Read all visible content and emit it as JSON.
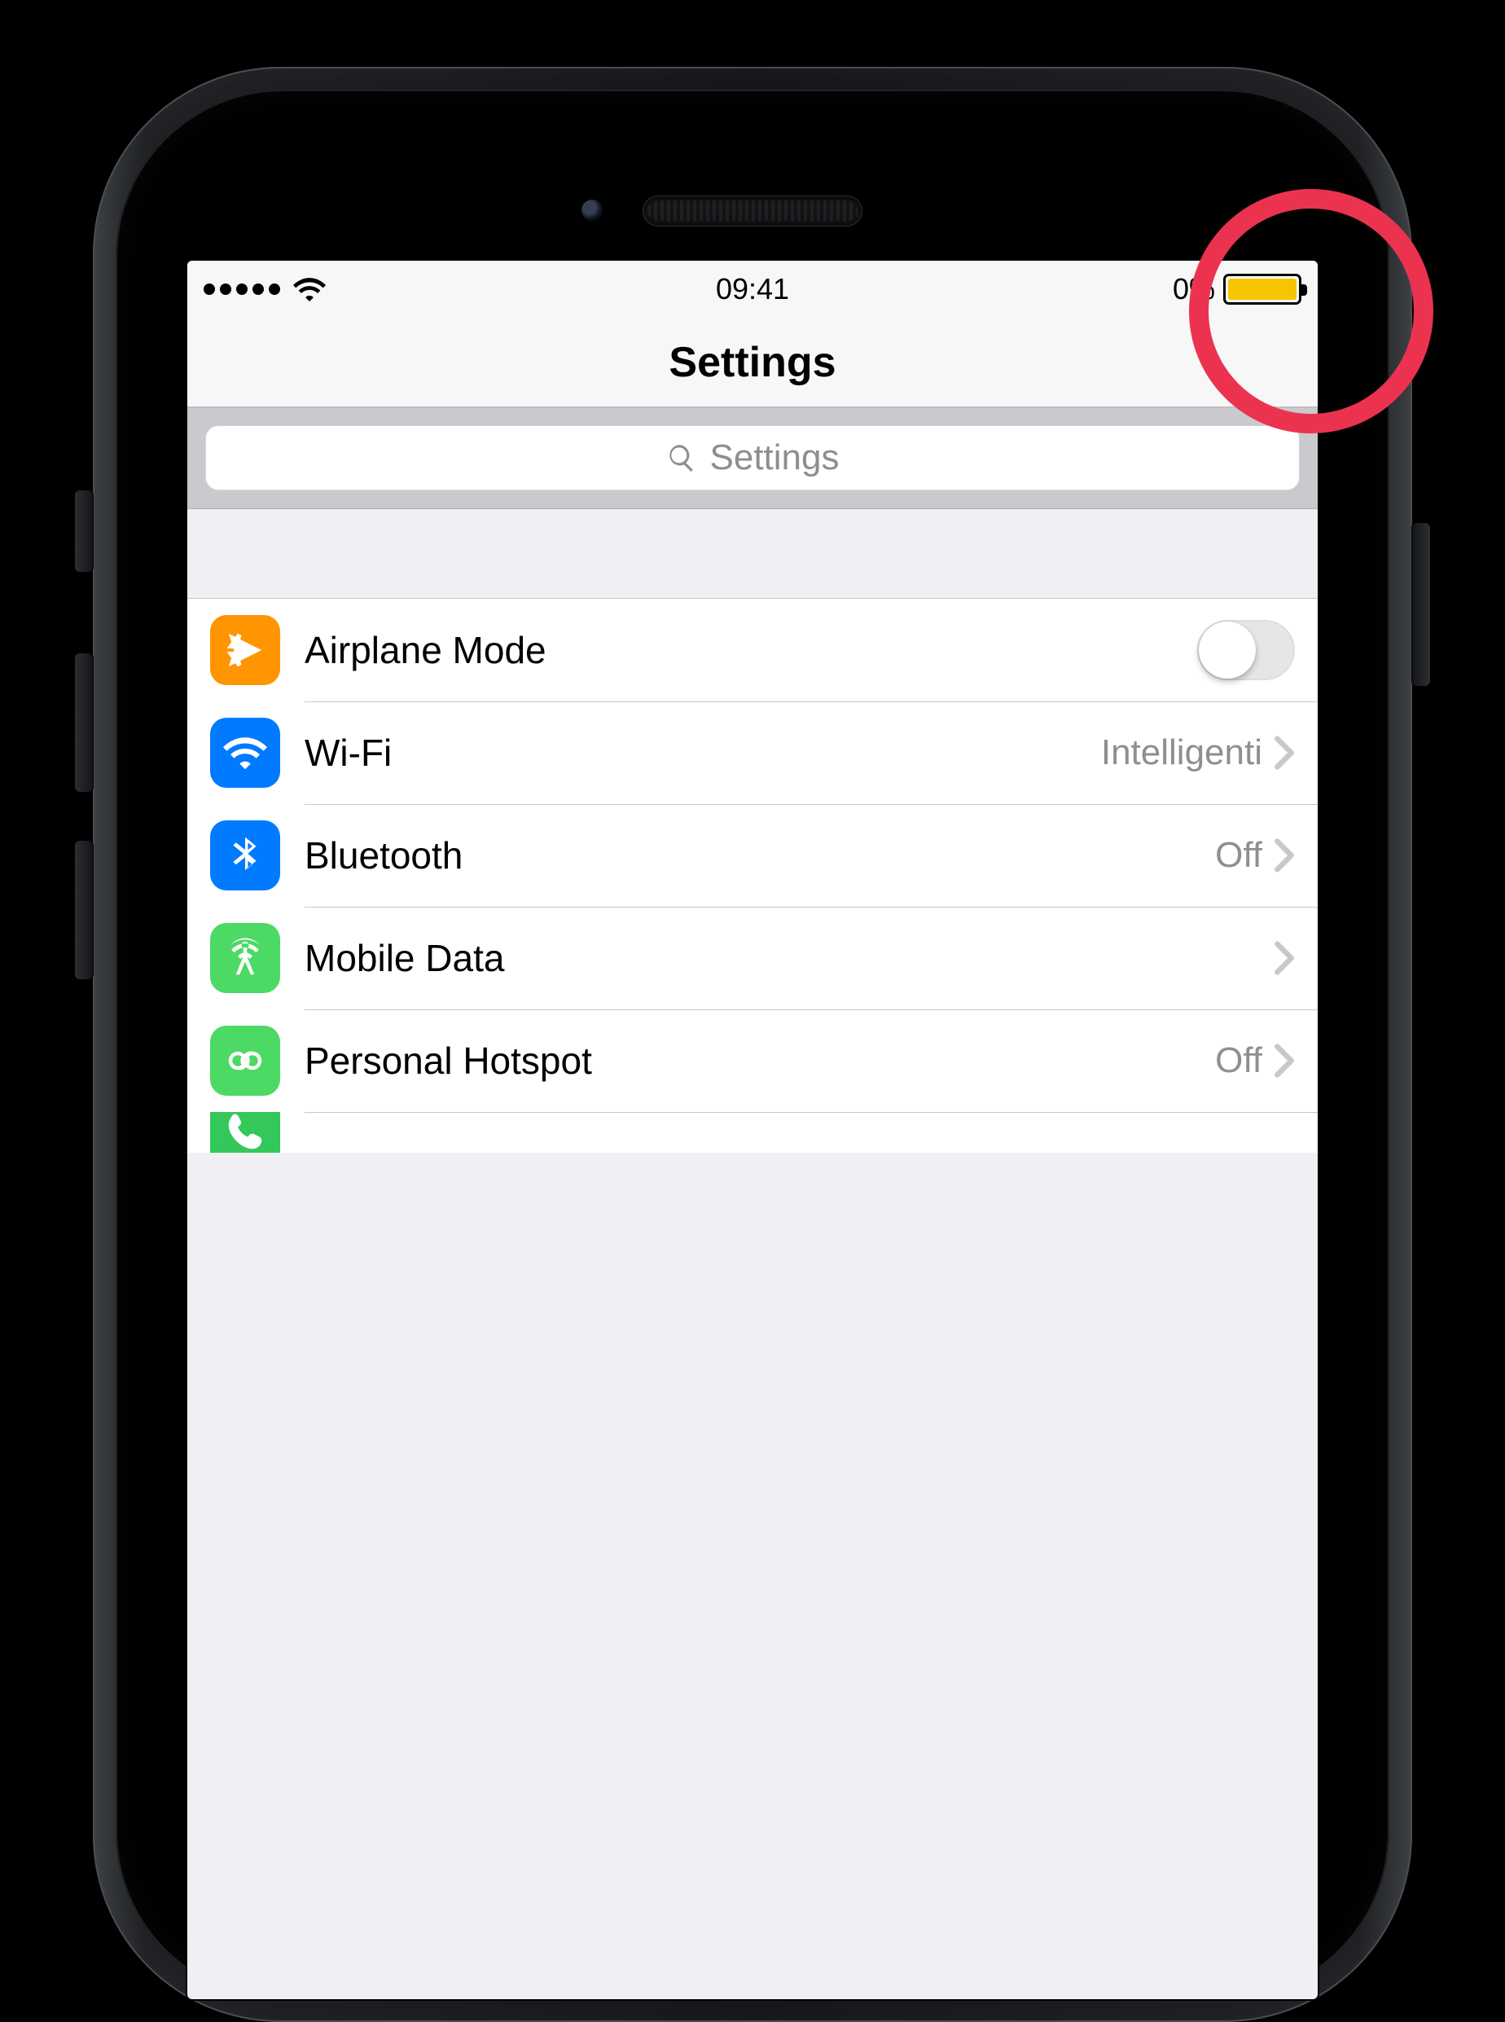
{
  "status_bar": {
    "time": "09:41",
    "battery_text": "0%",
    "battery_color": "#f7c500"
  },
  "header": {
    "title": "Settings"
  },
  "search": {
    "placeholder": "Settings"
  },
  "rows": [
    {
      "id": "airplane-mode",
      "label": "Airplane Mode",
      "value": "",
      "type": "toggle",
      "toggled": false,
      "icon": "airplane",
      "icon_bg": "ic-orange"
    },
    {
      "id": "wifi",
      "label": "Wi-Fi",
      "value": "Intelligenti",
      "type": "link",
      "icon": "wifi",
      "icon_bg": "ic-blue"
    },
    {
      "id": "bluetooth",
      "label": "Bluetooth",
      "value": "Off",
      "type": "link",
      "icon": "bluetooth",
      "icon_bg": "ic-blue"
    },
    {
      "id": "mobile-data",
      "label": "Mobile Data",
      "value": "",
      "type": "link",
      "icon": "antenna",
      "icon_bg": "ic-green"
    },
    {
      "id": "personal-hotspot",
      "label": "Personal Hotspot",
      "value": "Off",
      "type": "link",
      "icon": "hotspot",
      "icon_bg": "ic-green"
    },
    {
      "id": "carrier",
      "label": "",
      "value": "",
      "type": "link",
      "icon": "phone",
      "icon_bg": "ic-green2",
      "partial": true
    }
  ],
  "annotation": {
    "highlight_target": "battery-indicator"
  }
}
